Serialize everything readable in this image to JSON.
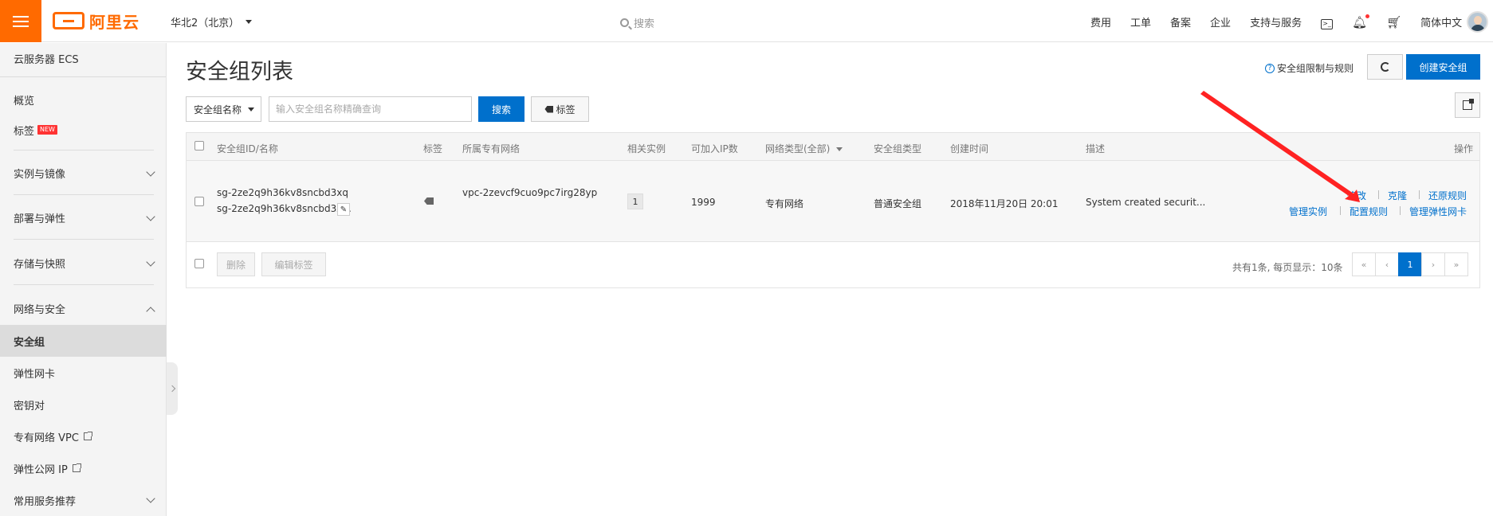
{
  "header": {
    "logo_text": "阿里云",
    "region": "华北2（北京）",
    "search_placeholder": "搜索",
    "nav": [
      "费用",
      "工单",
      "备案",
      "企业",
      "支持与服务"
    ],
    "language": "简体中文"
  },
  "sidebar": {
    "title": "云服务器 ECS",
    "overview": "概览",
    "tags": "标签",
    "new_badge": "NEW",
    "groups": {
      "instances": "实例与镜像",
      "deploy": "部署与弹性",
      "storage": "存储与快照",
      "network": "网络与安全"
    },
    "network_items": {
      "security_group": "安全组",
      "eni": "弹性网卡",
      "keypair": "密钥对",
      "vpc": "专有网络 VPC",
      "eip": "弹性公网 IP"
    },
    "recommend": "常用服务推荐"
  },
  "main": {
    "title": "安全组列表",
    "limit_link": "安全组限制与规则",
    "create_button": "创建安全组",
    "filter_select": "安全组名称",
    "search_placeholder": "输入安全组名称精确查询",
    "search_button": "搜索",
    "tag_button": "标签"
  },
  "table": {
    "headers": {
      "id_name": "安全组ID/名称",
      "tag": "标签",
      "vpc": "所属专有网络",
      "instances": "相关实例",
      "ip_count": "可加入IP数",
      "net_type": "网络类型(全部)",
      "sg_type": "安全组类型",
      "created": "创建时间",
      "desc": "描述",
      "ops": "操作"
    },
    "row": {
      "id": "sg-2ze2q9h36kv8sncbd3xq",
      "name": "sg-2ze2q9h36kv8sncbd3x...",
      "vpc": "vpc-2zevcf9cuo9pc7irg28yp",
      "instances": "1",
      "ip_count": "1999",
      "net_type": "专有网络",
      "sg_type": "普通安全组",
      "created": "2018年11月20日 20:01",
      "desc": "System created securit...",
      "ops": {
        "modify": "修改",
        "clone": "克隆",
        "restore": "还原规则",
        "manage_instances": "管理实例",
        "config_rules": "配置规则",
        "manage_eni": "管理弹性网卡"
      }
    },
    "footer": {
      "delete": "删除",
      "edit_tags": "编辑标签",
      "summary": "共有1条, 每页显示：10条",
      "pages": [
        "«",
        "‹",
        "1",
        "›",
        "»"
      ]
    }
  },
  "colors": {
    "brand": "#ff6a00",
    "primary": "#0070cc",
    "annotation_arrow": "#f22"
  }
}
